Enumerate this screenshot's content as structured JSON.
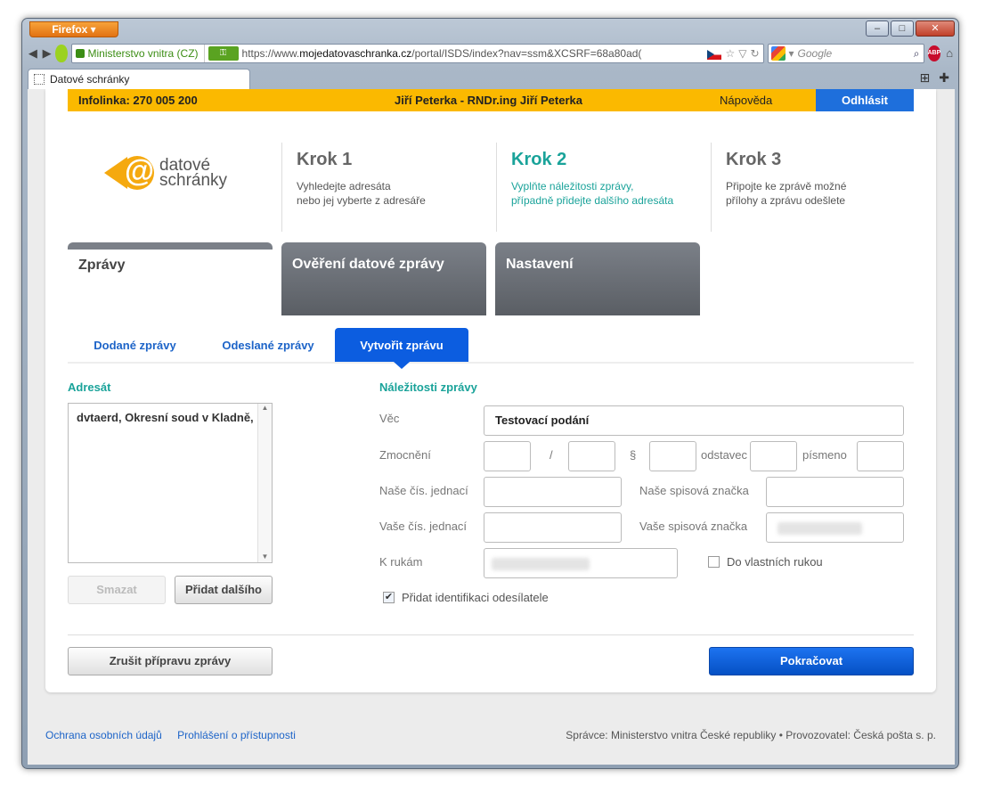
{
  "browser": {
    "app_button": "Firefox ▾",
    "identity_label": "Ministerstvo vnitra (CZ)",
    "url_prefix": "https://www.",
    "url_domain": "mojedatovaschranka.cz",
    "url_rest": "/portal/ISDS/index?nav=ssm&XCSRF=68a80ad(",
    "search_placeholder": "Google",
    "tab_title": "Datové schránky",
    "window_controls": [
      "–",
      "□",
      "✕"
    ]
  },
  "topbar": {
    "infoline": "Infolinka: 270 005 200",
    "user": "Jiří Peterka - RNDr.ing Jiří Peterka",
    "help": "Nápověda",
    "logout": "Odhlásit"
  },
  "logo": {
    "line1": "datové",
    "line2": "schránky"
  },
  "steps": [
    {
      "title": "Krok 1",
      "desc": "Vyhledejte adresáta\nnebo jej vyberte z adresáře",
      "active": false
    },
    {
      "title": "Krok 2",
      "desc": "Vyplňte náležitosti zprávy,\npřípadně přidejte dalšího adresáta",
      "active": true
    },
    {
      "title": "Krok 3",
      "desc": "Připojte ke zprávě možné\npřílohy a zprávu odešlete",
      "active": false
    }
  ],
  "main_tabs": [
    {
      "label": "Zprávy",
      "active": true
    },
    {
      "label": "Ověření datové zprávy",
      "active": false
    },
    {
      "label": "Nastavení",
      "active": false
    }
  ],
  "sub_tabs": [
    {
      "label": "Dodané zprávy",
      "active": false
    },
    {
      "label": "Odeslané zprávy",
      "active": false
    },
    {
      "label": "Vytvořit zprávu",
      "active": true
    }
  ],
  "recipient": {
    "heading": "Adresát",
    "value": "dvtaerd, Okresní soud v Kladně,",
    "delete_button": "Smazat",
    "add_button": "Přidat dalšího"
  },
  "message": {
    "heading": "Náležitosti zprávy",
    "subject_label": "Věc",
    "subject_value": "Testovací podání",
    "authorization_label": "Zmocnění",
    "slash": "/",
    "paragraph_sign": "§",
    "odstavec_label": "odstavec",
    "pismeno_label": "písmeno",
    "our_ref_label": "Naše čís. jednací",
    "our_file_label": "Naše spisová značka",
    "your_ref_label": "Vaše čís. jednací",
    "your_file_label": "Vaše spisová značka",
    "to_hands_label": "K rukám",
    "personal_delivery_label": "Do vlastních rukou",
    "personal_delivery_checked": false,
    "add_sender_id_label": "Přidat identifikaci odesílatele",
    "add_sender_id_checked": true
  },
  "actions": {
    "cancel": "Zrušit přípravu zprávy",
    "continue": "Pokračovat"
  },
  "footer": {
    "privacy": "Ochrana osobních údajů",
    "accessibility": "Prohlášení o přístupnosti",
    "operator": "Správce: Ministerstvo vnitra České republiky • Provozovatel: Česká pošta s. p."
  },
  "colors": {
    "accent_yellow": "#fbb900",
    "accent_blue": "#0c5de0",
    "accent_teal": "#1aa39a"
  }
}
